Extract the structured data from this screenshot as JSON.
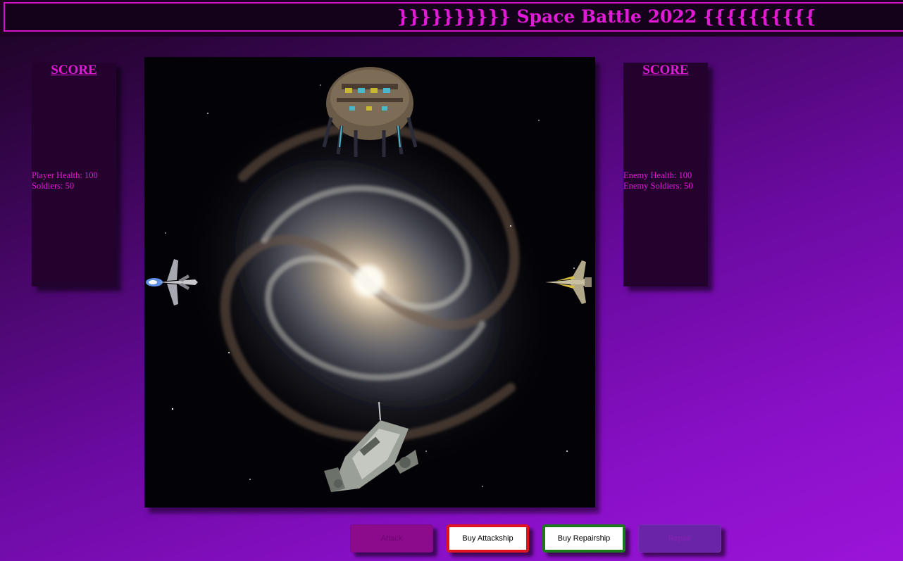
{
  "header": {
    "title": "}}}}}}}}}} Space Battle 2022 {{{{{{{{{{"
  },
  "player_panel": {
    "title": "SCORE",
    "health_label": "Player Health: 100",
    "soldiers_label": "Soldiers: 50"
  },
  "enemy_panel": {
    "title": "SCORE",
    "health_label": "Enemy Health: 100",
    "soldiers_label": "Enemy Soldiers: 50"
  },
  "game": {
    "background": "spiral-galaxy",
    "sprites": [
      "enemy-mothership",
      "player-fighter",
      "enemy-fighter",
      "player-cruiser"
    ]
  },
  "controls": {
    "attack_label": "Attack",
    "buy_attackship_label": "Buy Attackship",
    "buy_repairship_label": "Buy Repairship",
    "repair_label": "Repair"
  },
  "colors": {
    "accent": "#e01ad6",
    "attackship_border": "#e0141e",
    "repairship_border": "#1a7a1a"
  }
}
